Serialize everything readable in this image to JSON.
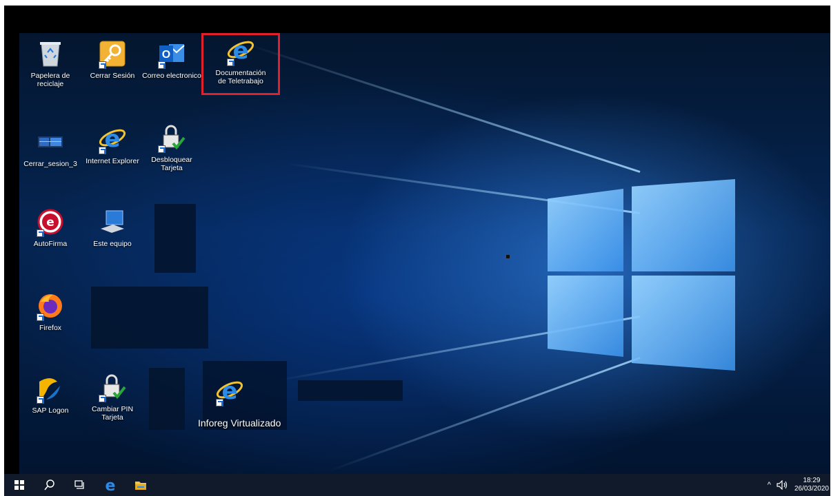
{
  "desktop": {
    "icons": [
      {
        "label": "Papelera de reciclaje",
        "icon": "recycle-bin-icon"
      },
      {
        "label": "Cerrar Sesión",
        "icon": "key-icon"
      },
      {
        "label": "Correo electronico",
        "icon": "outlook-icon"
      },
      {
        "label": "Documentación de Teletrabajo",
        "icon": "internet-explorer-icon",
        "highlighted": true
      },
      {
        "label": "Cerrar_sesion_3",
        "icon": "windows-logoff-icon"
      },
      {
        "label": "Internet Explorer",
        "icon": "internet-explorer-icon"
      },
      {
        "label": "Desbloquear Tarjeta",
        "icon": "padlock-check-icon"
      },
      {
        "label": "AutoFirma",
        "icon": "autofirma-icon"
      },
      {
        "label": "Este equipo",
        "icon": "computer-icon"
      },
      {
        "label": "Firefox",
        "icon": "firefox-icon"
      },
      {
        "label": "SAP Logon",
        "icon": "sap-logon-icon"
      },
      {
        "label": "Cambiar PIN Tarjeta",
        "icon": "padlock-check-icon"
      },
      {
        "label": "Inforeg Virtualizado",
        "icon": "internet-explorer-icon"
      }
    ],
    "highlight_color": "#e0202a"
  },
  "taskbar": {
    "buttons": [
      "start-icon",
      "search-icon",
      "task-view-icon",
      "edge-icon",
      "file-explorer-icon"
    ],
    "tray": {
      "chevron": "^",
      "volume": "volume-icon",
      "time": "18:29",
      "date": "26/03/2020"
    }
  },
  "colors": {
    "taskbar": "#101a2a",
    "accent": "#1b6bd6"
  }
}
